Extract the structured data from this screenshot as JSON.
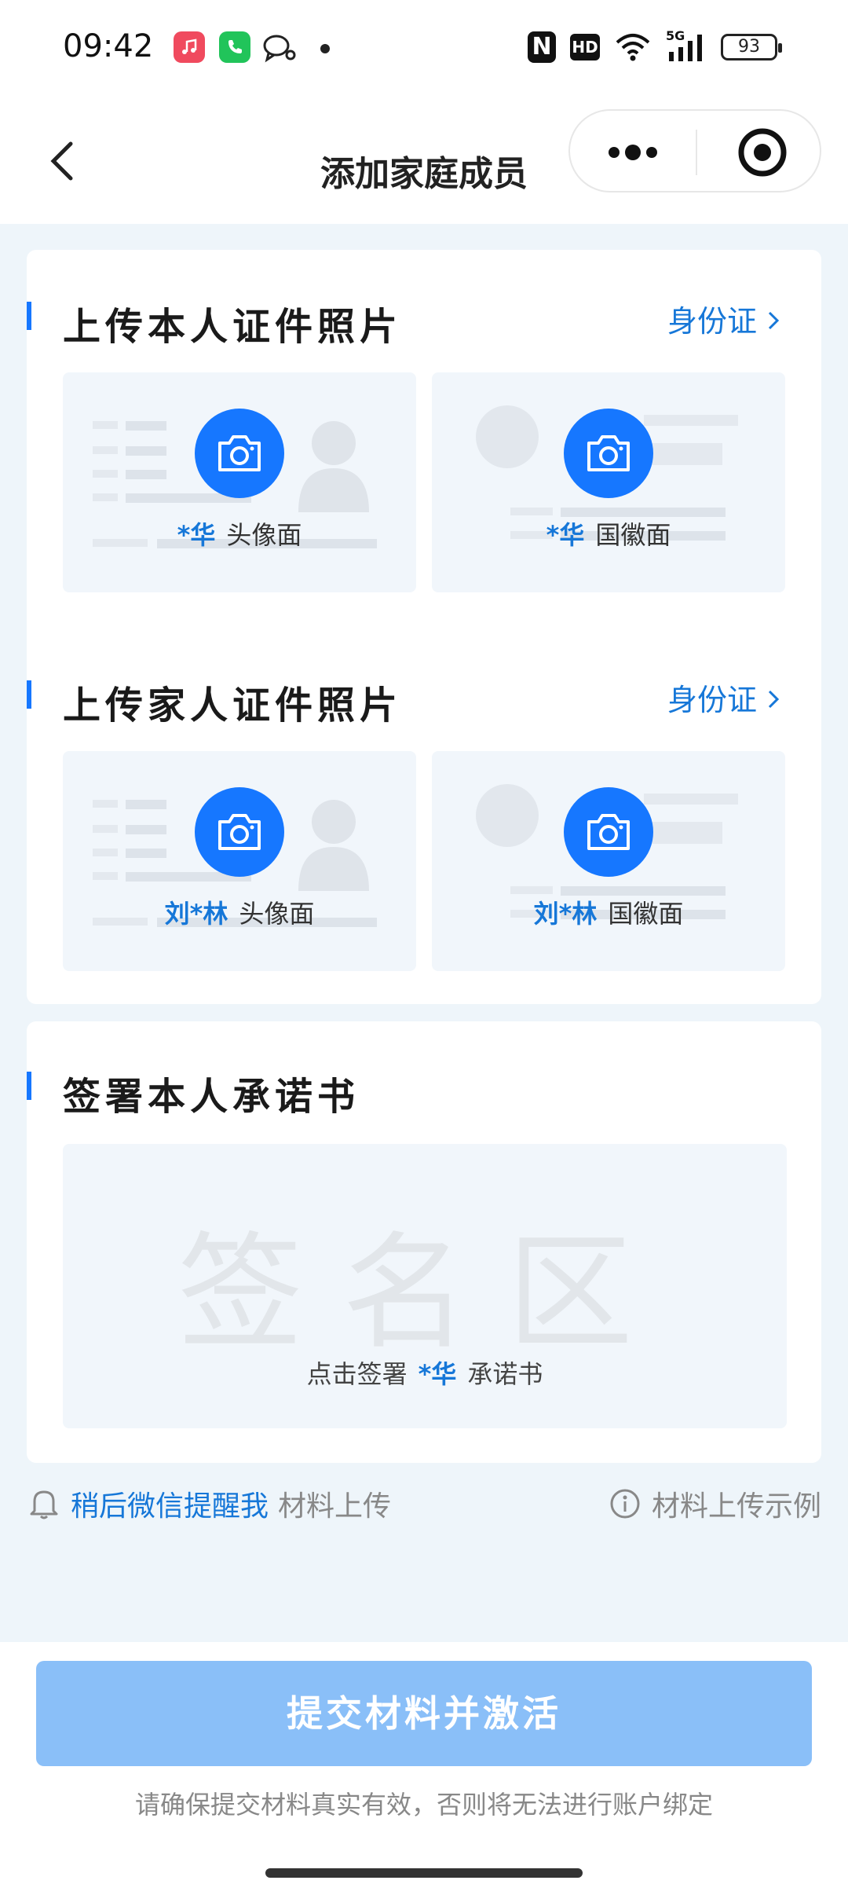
{
  "status_bar": {
    "time": "09:42",
    "apps": [
      "music-app-icon",
      "phone-app-icon",
      "chat-app-icon"
    ],
    "nfc": "N",
    "hd": "HD",
    "network": "5G",
    "battery": "93"
  },
  "nav": {
    "title": "添加家庭成员",
    "back_icon": "chevron-left-icon",
    "more_icon": "more-dots-icon",
    "target_icon": "target-icon"
  },
  "self_upload": {
    "title": "上传本人证件照片",
    "doc_type": "身份证",
    "front": {
      "name": "*华",
      "label": "头像面"
    },
    "back": {
      "name": "*华",
      "label": "国徽面"
    }
  },
  "family_upload": {
    "title": "上传家人证件照片",
    "doc_type": "身份证",
    "front": {
      "name": "刘*林",
      "label": "头像面"
    },
    "back": {
      "name": "刘*林",
      "label": "国徽面"
    }
  },
  "sign": {
    "title": "签署本人承诺书",
    "watermark": "签名区",
    "prefix": "点击签署",
    "name": "*华",
    "suffix": "承诺书"
  },
  "reminder": {
    "link": "稍后微信提醒我",
    "text": "材料上传"
  },
  "example_link": "材料上传示例",
  "footer": {
    "submit": "提交材料并激活",
    "note": "请确保提交材料真实有效，否则将无法进行账户绑定"
  },
  "colors": {
    "accent": "#1677ff",
    "link": "#1677d8",
    "button_disabled": "#8abff8",
    "background": "#eef5fa"
  }
}
